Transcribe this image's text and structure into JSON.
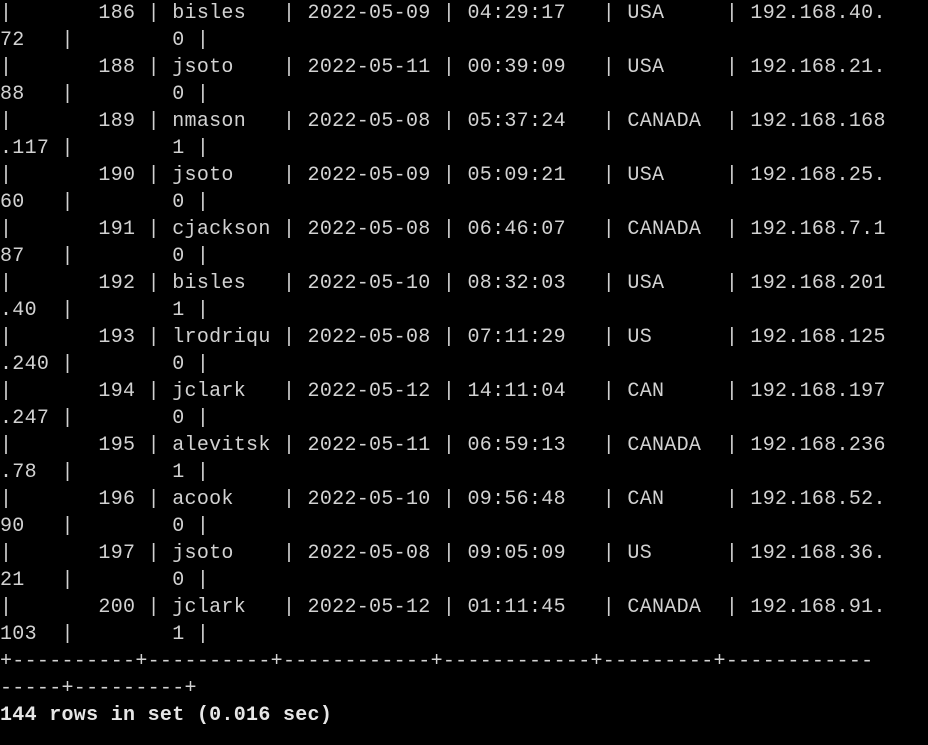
{
  "terminal": {
    "lines": [
      "|       186 | bisles   | 2022-05-09 | 04:29:17   | USA     | 192.168.40.",
      "72   |        0 |",
      "|       188 | jsoto    | 2022-05-11 | 00:39:09   | USA     | 192.168.21.",
      "88   |        0 |",
      "|       189 | nmason   | 2022-05-08 | 05:37:24   | CANADA  | 192.168.168",
      ".117 |        1 |",
      "|       190 | jsoto    | 2022-05-09 | 05:09:21   | USA     | 192.168.25.",
      "60   |        0 |",
      "|       191 | cjackson | 2022-05-08 | 06:46:07   | CANADA  | 192.168.7.1",
      "87   |        0 |",
      "|       192 | bisles   | 2022-05-10 | 08:32:03   | USA     | 192.168.201",
      ".40  |        1 |",
      "|       193 | lrodriqu | 2022-05-08 | 07:11:29   | US      | 192.168.125",
      ".240 |        0 |",
      "|       194 | jclark   | 2022-05-12 | 14:11:04   | CAN     | 192.168.197",
      ".247 |        0 |",
      "|       195 | alevitsk | 2022-05-11 | 06:59:13   | CANADA  | 192.168.236",
      ".78  |        1 |",
      "|       196 | acook    | 2022-05-10 | 09:56:48   | CAN     | 192.168.52.",
      "90   |        0 |",
      "|       197 | jsoto    | 2022-05-08 | 09:05:09   | US      | 192.168.36.",
      "21   |        0 |",
      "|       200 | jclark   | 2022-05-12 | 01:11:45   | CANADA  | 192.168.91.",
      "103  |        1 |",
      "+----------+----------+------------+------------+---------+------------",
      "-----+---------+"
    ],
    "summary": "144 rows in set (0.016 sec)"
  }
}
